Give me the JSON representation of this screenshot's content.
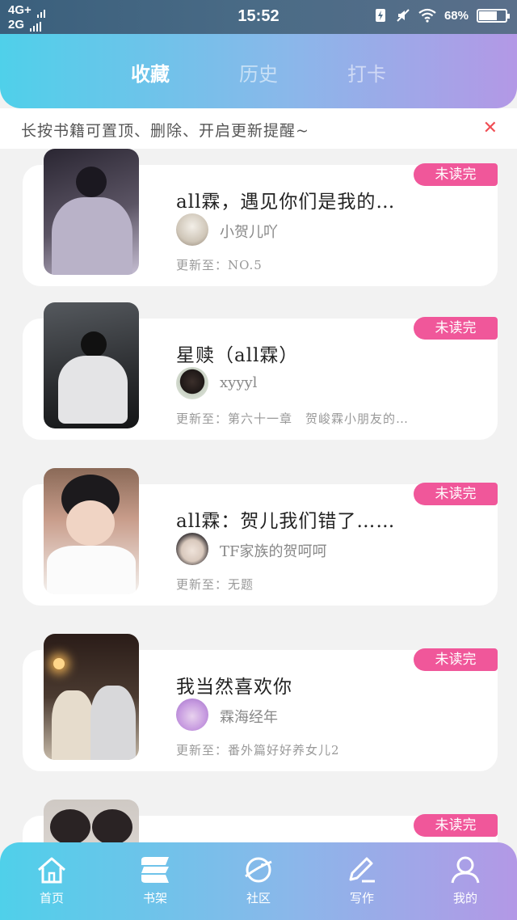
{
  "status_bar": {
    "network_top": "4G+",
    "network_bottom": "2G",
    "time": "15:52",
    "battery": "68%",
    "battery_level": 0.68
  },
  "header": {
    "tabs": [
      {
        "label": "收藏",
        "active": true
      },
      {
        "label": "历史",
        "active": false
      },
      {
        "label": "打卡",
        "active": false
      }
    ]
  },
  "tip": {
    "text": "长按书籍可置顶、删除、开启更新提醒~",
    "close": "✕"
  },
  "books": [
    {
      "title": "all霖，遇见你们是我的…",
      "author": "小贺儿吖",
      "update": "更新至：NO.5",
      "tag": "未读完"
    },
    {
      "title": "星赎（all霖）",
      "author": "xyyyl",
      "update": "更新至：第六十一章　贺峻霖小朋友的…",
      "tag": "未读完"
    },
    {
      "title": "all霖：贺儿我们错了……",
      "author": "TF家族的贺呵呵",
      "update": "更新至：无题",
      "tag": "未读完"
    },
    {
      "title": "我当然喜欢你",
      "author": "霖海经年",
      "update": "更新至：番外篇好好养女儿2",
      "tag": "未读完"
    },
    {
      "title": "",
      "author": "",
      "update": "",
      "tag": "未读完"
    }
  ],
  "bottom_nav": [
    {
      "label": "首页",
      "icon": "home-icon"
    },
    {
      "label": "书架",
      "icon": "bookshelf-icon"
    },
    {
      "label": "社区",
      "icon": "planet-icon"
    },
    {
      "label": "写作",
      "icon": "pen-icon"
    },
    {
      "label": "我的",
      "icon": "user-icon"
    }
  ],
  "colors": {
    "gradient_start": "#4fd0ea",
    "gradient_end": "#b398e6",
    "tag_pink": "#f0579a",
    "close_red": "#f04e55"
  }
}
